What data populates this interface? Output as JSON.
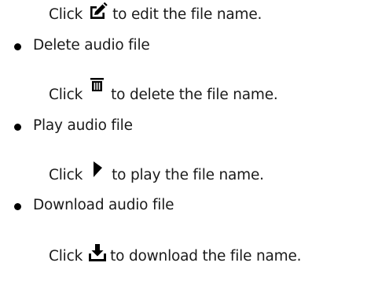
{
  "instructions": [
    {
      "type": "click",
      "prefix": "Click",
      "icon": "edit-icon",
      "suffix": "to edit the file name."
    },
    {
      "type": "bullet",
      "text": "Delete audio file"
    },
    {
      "type": "click",
      "prefix": "Click",
      "icon": "trash-icon",
      "suffix": "to delete the file name."
    },
    {
      "type": "bullet",
      "text": "Play audio file"
    },
    {
      "type": "click",
      "prefix": "Click",
      "icon": "play-icon",
      "suffix": "to play the file name."
    },
    {
      "type": "bullet",
      "text": "Download audio file"
    },
    {
      "type": "click",
      "prefix": "Click",
      "icon": "download-icon",
      "suffix": "to download the file name."
    }
  ],
  "colors": {
    "text": "#1a1a1a",
    "icon": "#000000"
  }
}
